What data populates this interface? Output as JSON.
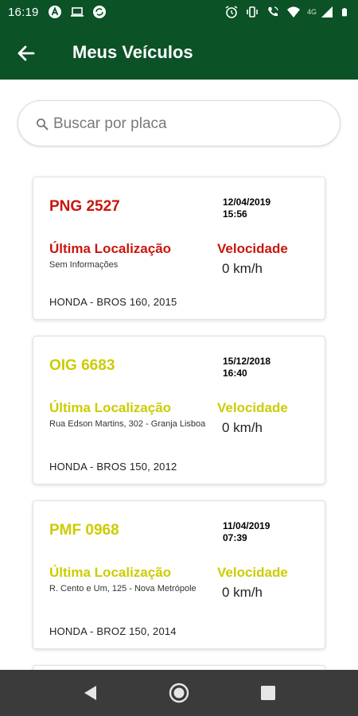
{
  "status_bar": {
    "time": "16:19",
    "network_label": "4G",
    "left_icons": [
      "a-circle-icon",
      "laptop-icon",
      "sync-icon"
    ],
    "right_icons": [
      "alarm-icon",
      "vibrate-icon",
      "wifi-calling-icon",
      "wifi-icon",
      "signal-icon",
      "battery-icon"
    ]
  },
  "header": {
    "title": "Meus Veículos",
    "back_icon": "arrow-left-icon"
  },
  "search": {
    "placeholder": "Buscar por placa",
    "value": "",
    "icon": "search-icon"
  },
  "vehicles": [
    {
      "plate": "PNG 2527",
      "date": "12/04/2019",
      "time": "15:56",
      "location_label": "Última Localização",
      "location_value": "Sem Informações",
      "speed_label": "Velocidade",
      "speed_value": "0 km/h",
      "model": "HONDA - BROS 160, 2015",
      "status_color": "#c9160e"
    },
    {
      "plate": "OIG 6683",
      "date": "15/12/2018",
      "time": "16:40",
      "location_label": "Última Localização",
      "location_value": "Rua Edson Martins, 302  - Granja Lisboa",
      "speed_label": "Velocidade",
      "speed_value": "0 km/h",
      "model": "HONDA - BROS 150, 2012",
      "status_color": "#cccc00"
    },
    {
      "plate": "PMF 0968",
      "date": "11/04/2019",
      "time": "07:39",
      "location_label": "Última Localização",
      "location_value": "R. Cento e Um, 125  - Nova Metrópole",
      "speed_label": "Velocidade",
      "speed_value": "0 km/h",
      "model": "HONDA - BROZ 150, 2014",
      "status_color": "#cccc00"
    }
  ],
  "colors": {
    "app_bar": "#0b5227",
    "nav_bar": "#3b3b3b",
    "status_red": "#c9160e",
    "status_yellow": "#cccc00"
  },
  "navigation": {
    "back_icon": "triangle-back-icon",
    "home_icon": "circle-home-icon",
    "recents_icon": "square-recents-icon"
  }
}
